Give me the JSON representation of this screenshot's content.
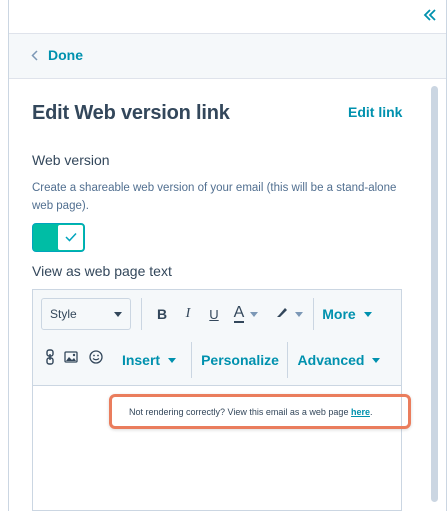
{
  "header": {
    "collapse_icon": "double-chevron-left-icon",
    "done_label": "Done"
  },
  "panel": {
    "title": "Edit Web version link",
    "edit_link_label": "Edit link",
    "web_version_label": "Web version",
    "help_text": "Create a shareable web version of your email (this will be a stand-alone web page).",
    "toggle_on": true,
    "view_text_label": "View as web page text"
  },
  "toolbar": {
    "style_select": "Style",
    "bold": "B",
    "italic": "I",
    "underline": "U",
    "font_color": "A",
    "more_label": "More",
    "insert_label": "Insert",
    "personalize_label": "Personalize",
    "advanced_label": "Advanced"
  },
  "editor": {
    "footer_text": "Not rendering correctly? View this email as a web page",
    "footer_link": "here",
    "footer_end": "."
  },
  "colors": {
    "accent": "#0091ae",
    "toggle": "#00bda5",
    "highlight": "#ea7d5d",
    "text": "#33475b"
  }
}
